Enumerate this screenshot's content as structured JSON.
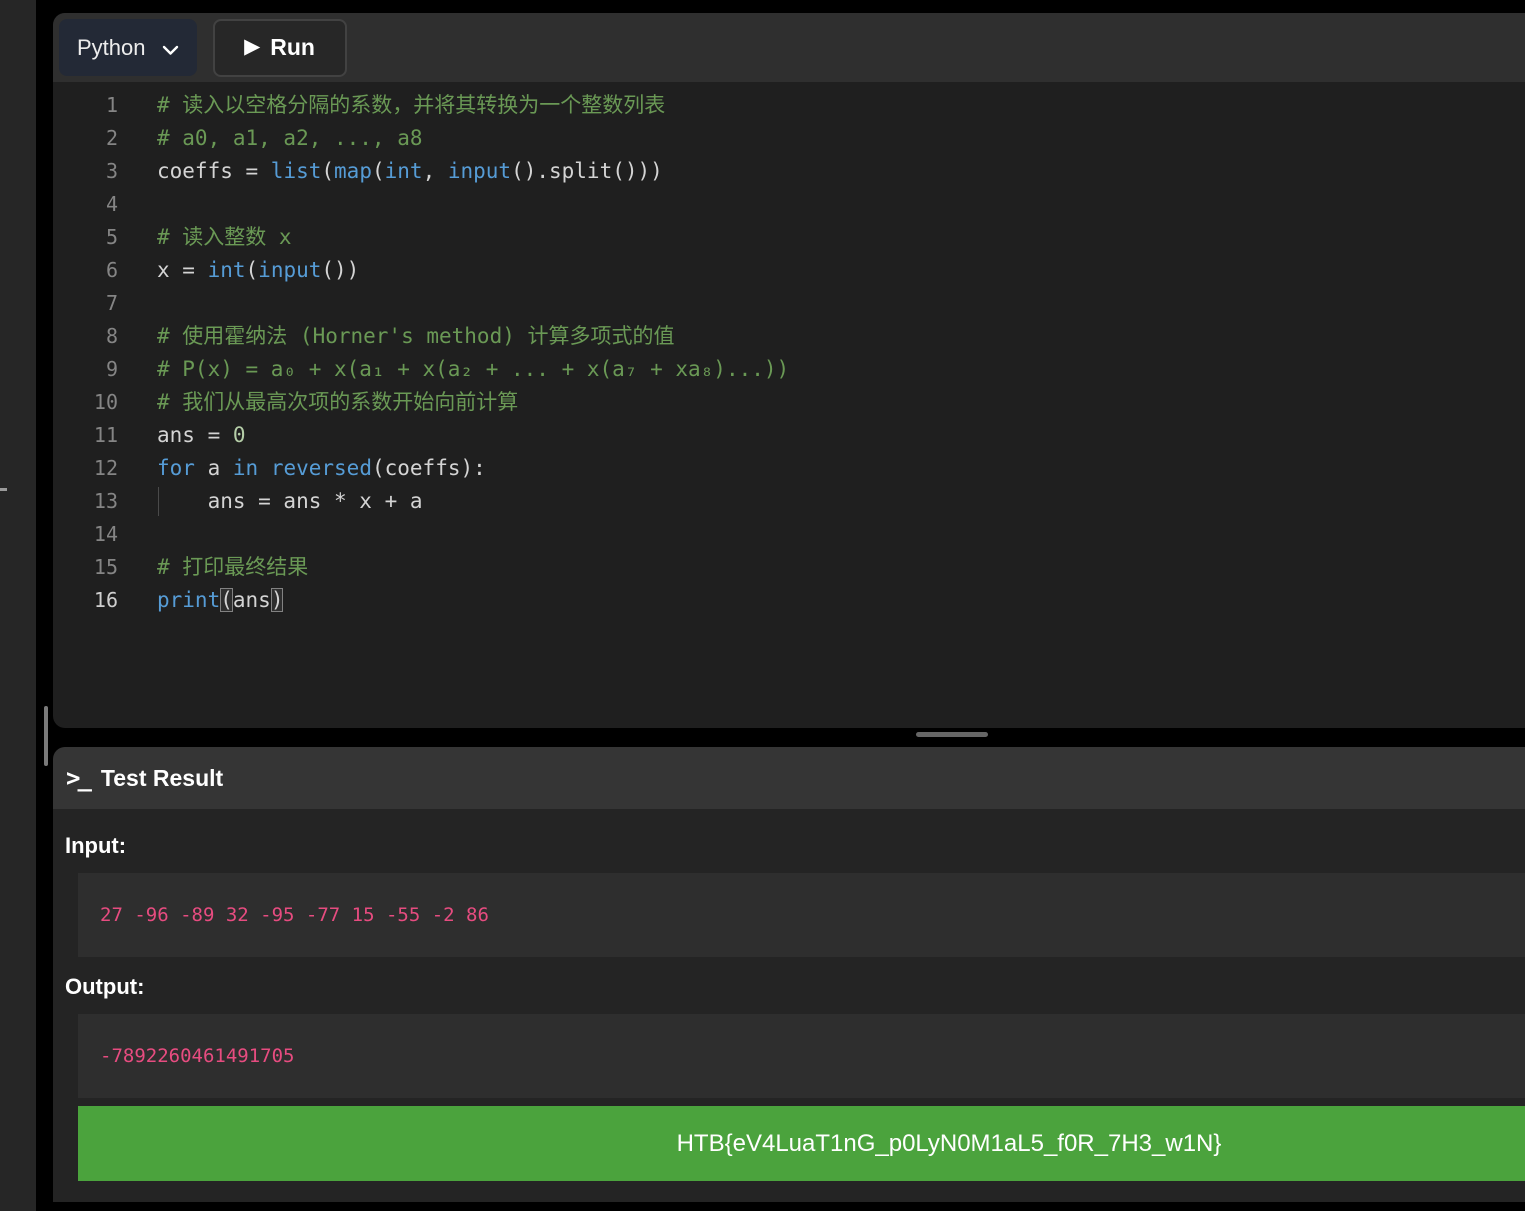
{
  "toolbar": {
    "language_selector": {
      "label": "Python"
    },
    "run_button": {
      "label": "Run",
      "play_icon": "▶"
    }
  },
  "editor": {
    "language": "Python",
    "lines": [
      {
        "num": "1",
        "segments": [
          [
            "comment",
            "# 读入以空格分隔的系数，并将其转换为一个整数列表"
          ]
        ]
      },
      {
        "num": "2",
        "segments": [
          [
            "comment",
            "# a0, a1, a2, ..., a8"
          ]
        ]
      },
      {
        "num": "3",
        "segments": [
          [
            "plain",
            "coeffs = "
          ],
          [
            "keyword",
            "list"
          ],
          [
            "plain",
            "("
          ],
          [
            "keyword",
            "map"
          ],
          [
            "plain",
            "("
          ],
          [
            "keyword",
            "int"
          ],
          [
            "plain",
            ", "
          ],
          [
            "keyword",
            "input"
          ],
          [
            "plain",
            "().split()))"
          ]
        ]
      },
      {
        "num": "4",
        "segments": []
      },
      {
        "num": "5",
        "segments": [
          [
            "comment",
            "# 读入整数 x"
          ]
        ]
      },
      {
        "num": "6",
        "segments": [
          [
            "plain",
            "x = "
          ],
          [
            "keyword",
            "int"
          ],
          [
            "plain",
            "("
          ],
          [
            "keyword",
            "input"
          ],
          [
            "plain",
            "())"
          ]
        ]
      },
      {
        "num": "7",
        "segments": []
      },
      {
        "num": "8",
        "segments": [
          [
            "comment",
            "# 使用霍纳法 (Horner's method) 计算多项式的值"
          ]
        ]
      },
      {
        "num": "9",
        "segments": [
          [
            "comment",
            "# P(x) = a₀ + x(a₁ + x(a₂ + ... + x(a₇ + xa₈)...))"
          ]
        ]
      },
      {
        "num": "10",
        "segments": [
          [
            "comment",
            "# 我们从最高次项的系数开始向前计算"
          ]
        ]
      },
      {
        "num": "11",
        "segments": [
          [
            "plain",
            "ans = "
          ],
          [
            "number",
            "0"
          ]
        ]
      },
      {
        "num": "12",
        "segments": [
          [
            "keyword",
            "for"
          ],
          [
            "plain",
            " a "
          ],
          [
            "keyword",
            "in"
          ],
          [
            "plain",
            " "
          ],
          [
            "keyword",
            "reversed"
          ],
          [
            "plain",
            "(coeffs):"
          ]
        ]
      },
      {
        "num": "13",
        "guide": true,
        "segments": [
          [
            "plain",
            "    ans = ans * x + a"
          ]
        ]
      },
      {
        "num": "14",
        "segments": []
      },
      {
        "num": "15",
        "segments": [
          [
            "comment",
            "# 打印最终结果"
          ]
        ]
      },
      {
        "num": "16",
        "active": true,
        "segments": [
          [
            "keyword",
            "print"
          ],
          [
            "bracket",
            "("
          ],
          [
            "plain",
            "ans"
          ],
          [
            "bracket",
            ")"
          ]
        ]
      }
    ]
  },
  "test_result": {
    "terminal_icon": ">_",
    "title": "Test Result",
    "input_label": "Input:",
    "input_value": "27 -96 -89 32 -95 -77 15 -55 -2 86",
    "output_label": "Output:",
    "output_value": "-7892260461491705",
    "flag": "HTB{eV4LuaT1nG_p0LyN0M1aL5_f0R_7H3_w1N}"
  },
  "colors": {
    "comment_green": "#6a9955",
    "keyword_blue": "#569cd6",
    "number_green": "#b5cea8",
    "code_text": "#d4d4d4",
    "io_value_pink": "#e74c80",
    "success_banner_green": "#4ba33d",
    "editor_bg": "#1f1f1f",
    "toolbar_bg": "#2f2f2f",
    "language_button_bg": "#232936",
    "test_panel_bg": "#242424",
    "test_header_bg": "#353535",
    "io_box_bg": "#2e2e2e"
  }
}
